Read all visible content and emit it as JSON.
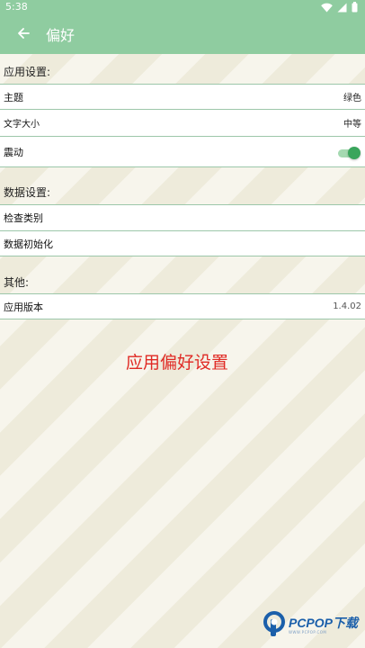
{
  "status_bar": {
    "time": "5:38",
    "icons": [
      "wifi-icon",
      "signal-icon",
      "battery-icon"
    ]
  },
  "app_bar": {
    "back_icon": "arrow-left-icon",
    "title": "偏好"
  },
  "sections": {
    "app_settings": {
      "header": "应用设置:",
      "theme": {
        "label": "主题",
        "value": "绿色"
      },
      "font_size": {
        "label": "文字大小",
        "value": "中等"
      },
      "vibration": {
        "label": "震动",
        "enabled": true
      }
    },
    "data_settings": {
      "header": "数据设置:",
      "check_category": {
        "label": "检查类别"
      },
      "data_init": {
        "label": "数据初始化"
      }
    },
    "other": {
      "header": "其他:",
      "app_version": {
        "label": "应用版本",
        "value": "1.4.02"
      }
    }
  },
  "caption": "应用偏好设置",
  "watermark": {
    "text": "PCPOP下载",
    "subtext": "WWW.PCPOP.COM"
  },
  "colors": {
    "primary": "#8fcca0",
    "accent": "#3aa55c",
    "caption": "#e02a24",
    "watermark": "#1b5faa"
  }
}
